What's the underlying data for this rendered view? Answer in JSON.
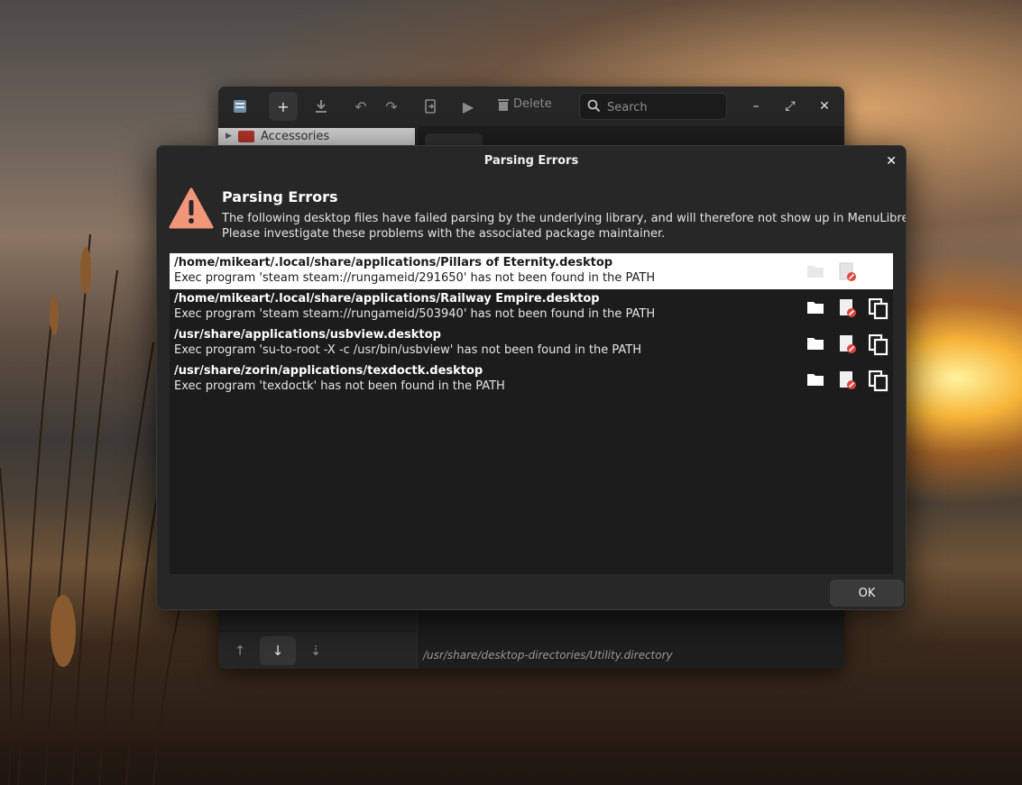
{
  "main_window": {
    "toolbar": {
      "delete_label": "Delete",
      "search_placeholder": "Search"
    },
    "sidebar": {
      "tree_item": "Accessories"
    },
    "directory_path": "/usr/share/desktop-directories/Utility.directory"
  },
  "dialog": {
    "title": "Parsing Errors",
    "heading": "Parsing Errors",
    "body_line1": "The following desktop files have failed parsing by the underlying library, and will therefore not show up in MenuLibre.",
    "body_line2": "Please investigate these problems with the associated package maintainer.",
    "errors": [
      {
        "path": "/home/mikeart/.local/share/applications/Pillars of Eternity.desktop",
        "message": "Exec program 'steam steam://rungameid/291650' has not been found in the PATH"
      },
      {
        "path": "/home/mikeart/.local/share/applications/Railway Empire.desktop",
        "message": "Exec program 'steam steam://rungameid/503940' has not been found in the PATH"
      },
      {
        "path": "/usr/share/applications/usbview.desktop",
        "message": "Exec program 'su-to-root -X -c /usr/bin/usbview' has not been found in the PATH"
      },
      {
        "path": "/usr/share/zorin/applications/texdoctk.desktop",
        "message": "Exec program 'texdoctk' has not been found in the PATH"
      }
    ],
    "ok_label": "OK"
  },
  "colors": {
    "warning": "#f2967a",
    "delete_badge": "#e0443a",
    "selected_row": "#ffffff"
  }
}
